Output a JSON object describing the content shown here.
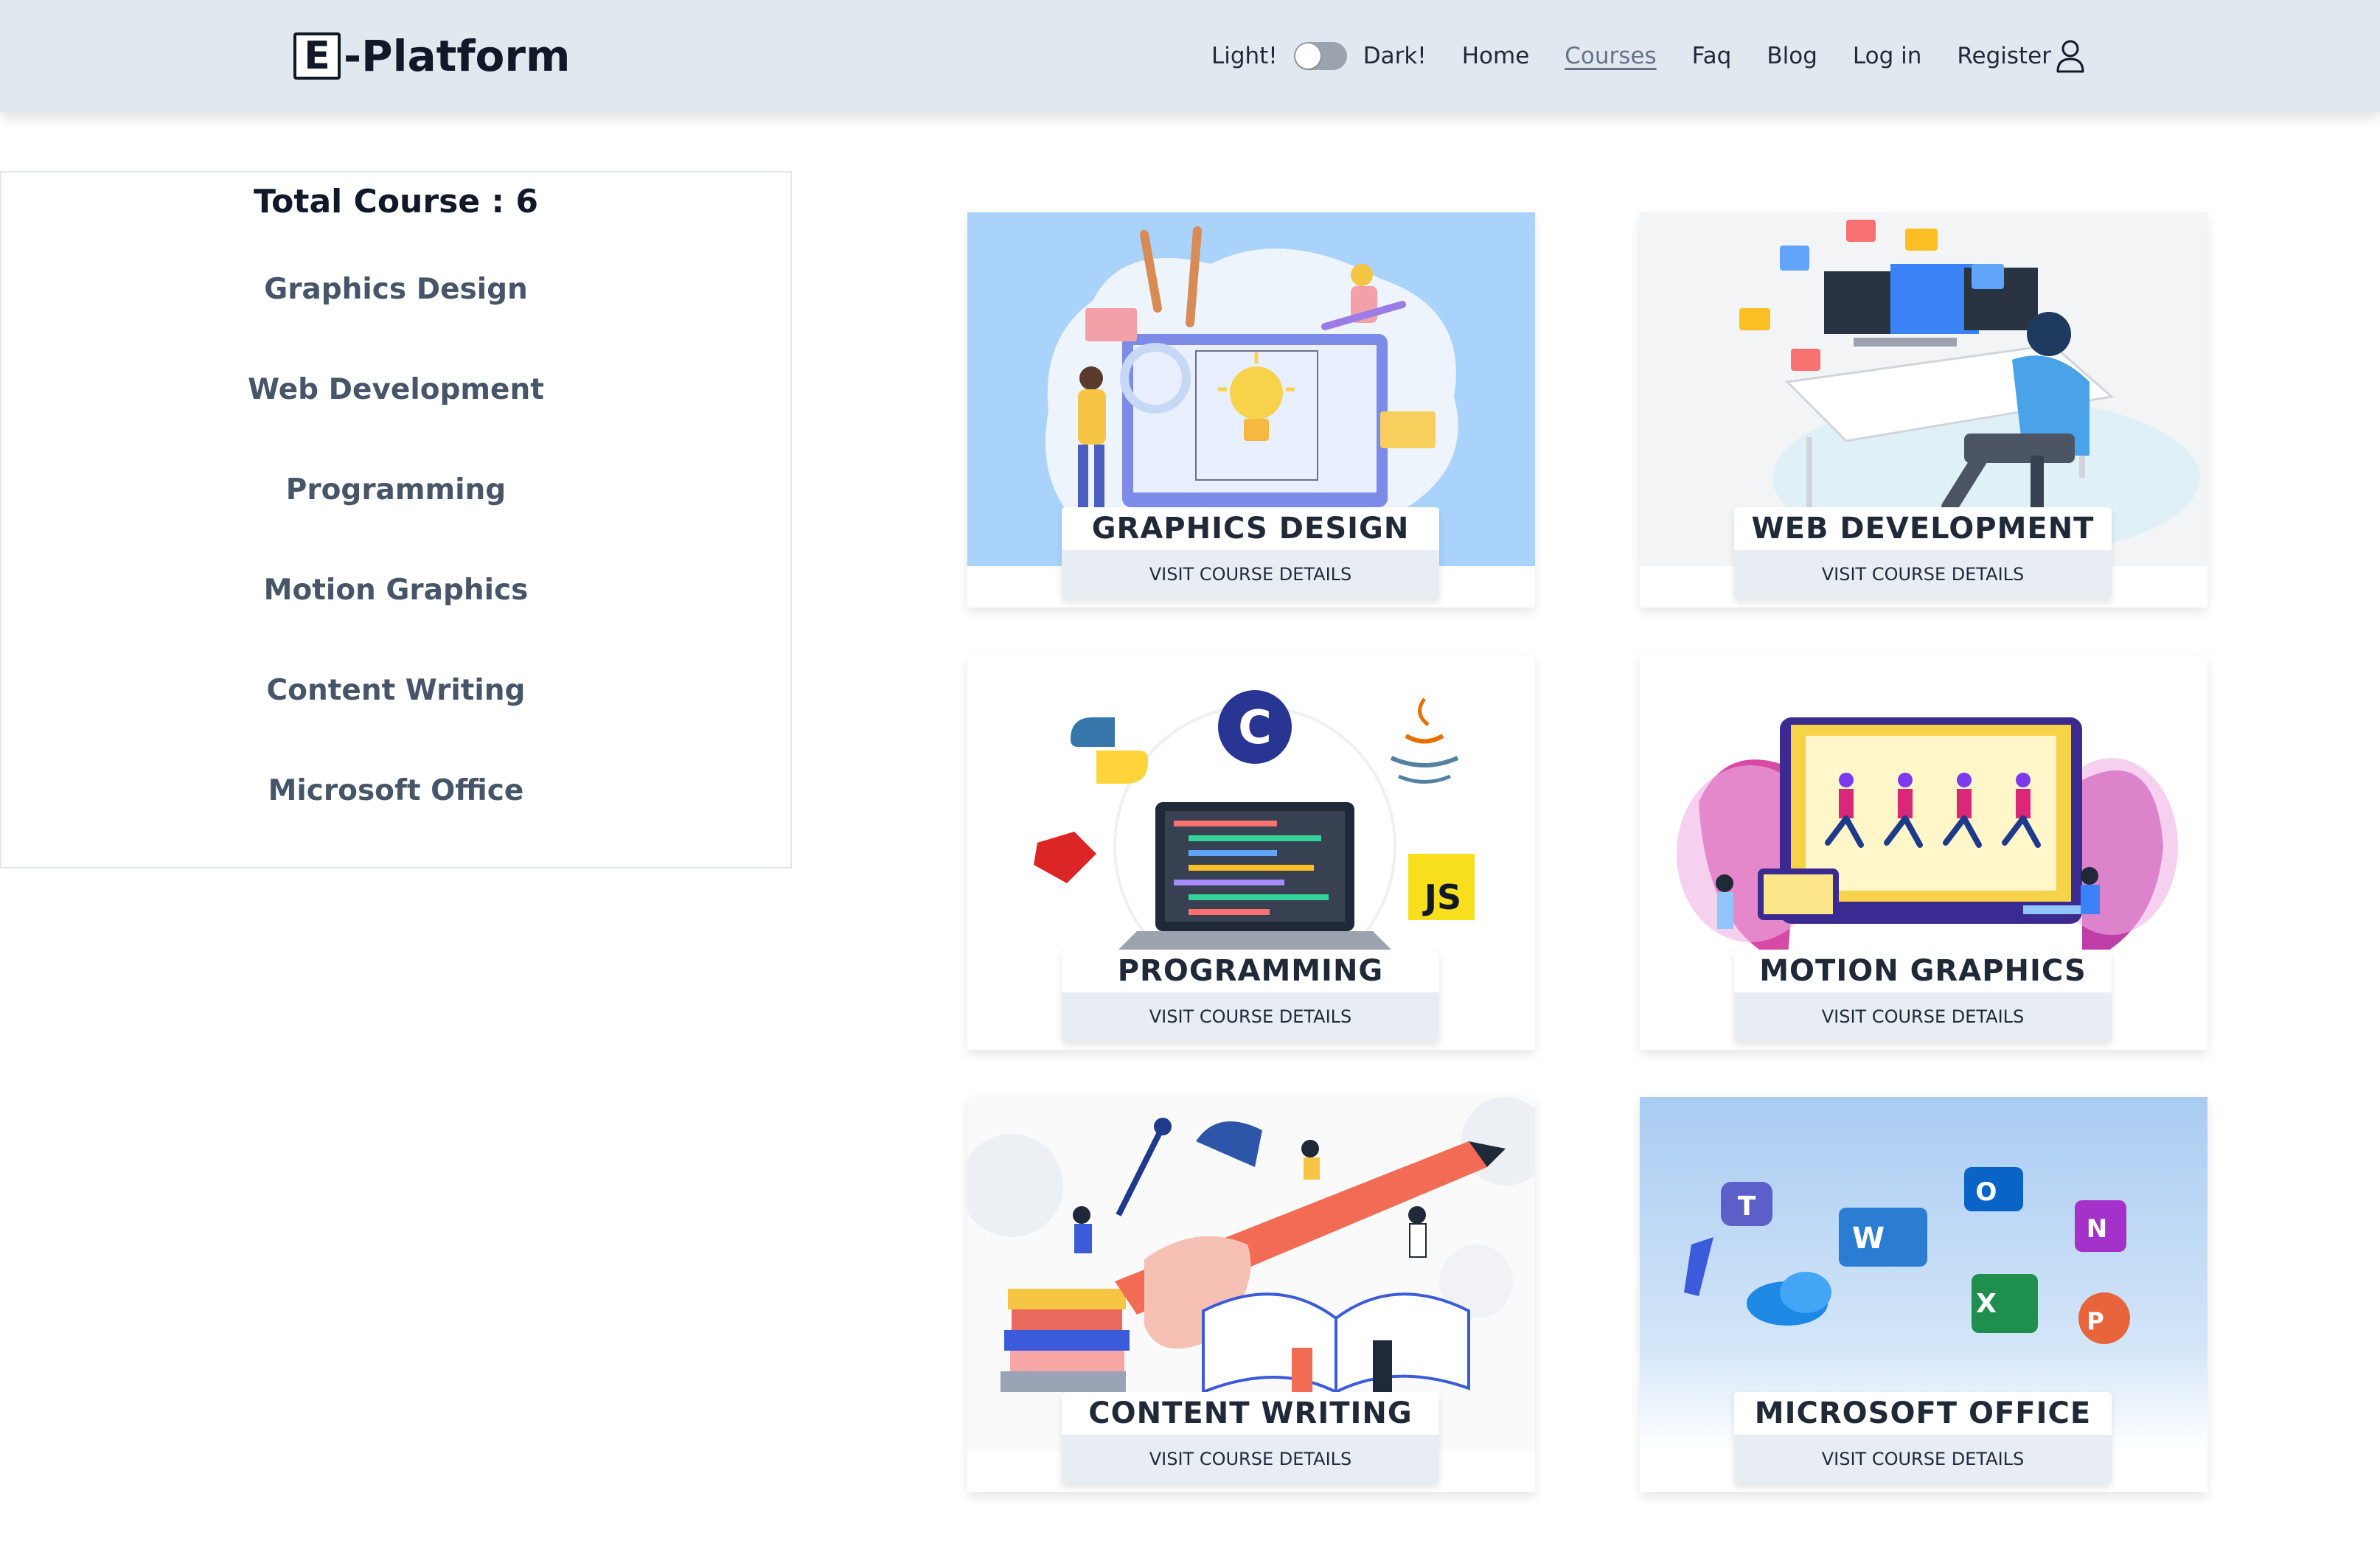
{
  "brand": {
    "icon_letter": "E",
    "name": "-Platform"
  },
  "nav": {
    "light_label": "Light!",
    "dark_label": "Dark!",
    "theme_toggle_on": false,
    "links": [
      "Home",
      "Courses",
      "Faq",
      "Blog",
      "Log in",
      "Register"
    ],
    "active": "Courses",
    "register_icon": "user-icon"
  },
  "sidebar": {
    "total_label": "Total Course : 6",
    "categories": [
      "Graphics Design",
      "Web Development",
      "Programming",
      "Motion Graphics",
      "Content Writing",
      "Microsoft Office"
    ]
  },
  "cards": [
    {
      "title": "GRAPHICS DESIGN",
      "button": "VISIT COURSE DETAILS",
      "image": "graphics-design-illustration",
      "bg": "#a9d3fb"
    },
    {
      "title": "WEB DEVELOPMENT",
      "button": "VISIT COURSE DETAILS",
      "image": "web-development-illustration",
      "bg": "#f3f4f6"
    },
    {
      "title": "PROGRAMMING",
      "button": "VISIT COURSE DETAILS",
      "image": "programming-illustration",
      "bg": "#ffffff"
    },
    {
      "title": "MOTION GRAPHICS",
      "button": "VISIT COURSE DETAILS",
      "image": "motion-graphics-illustration",
      "bg": "#ffffff"
    },
    {
      "title": "CONTENT WRITING",
      "button": "VISIT COURSE DETAILS",
      "image": "content-writing-illustration",
      "bg": "#fafafa"
    },
    {
      "title": "MICROSOFT OFFICE",
      "button": "VISIT COURSE DETAILS",
      "image": "microsoft-office-illustration",
      "bg": "#c7dff6"
    }
  ]
}
